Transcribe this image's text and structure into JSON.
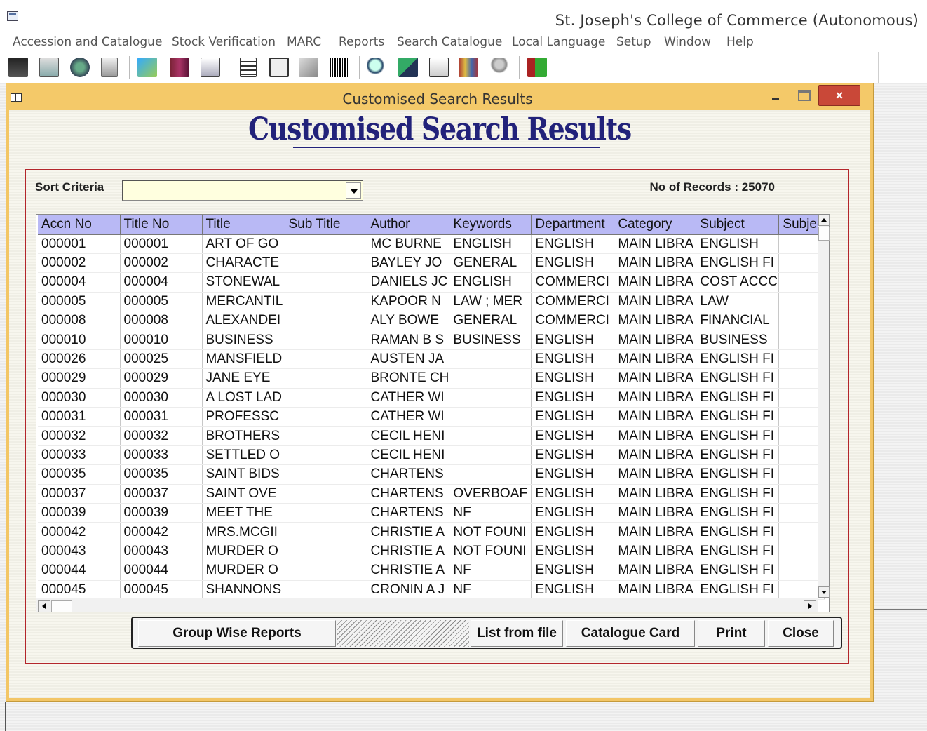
{
  "app": {
    "title": "St. Joseph's College of Commerce (Autonomous)",
    "menu": [
      "Accession and Catalogue",
      "Stock Verification",
      "MARC",
      "Reports",
      "Search Catalogue",
      "Local Language",
      "Setup",
      "Window",
      "Help"
    ]
  },
  "toolbar": {
    "icons": [
      "book-icon",
      "catalogue-icon",
      "globe-icon",
      "copy-icon",
      "stamp-icon",
      "books-icon",
      "mail-icon",
      "document-icon",
      "list-icon",
      "hand-icon",
      "barcode-icon",
      "search-icon",
      "find-book-icon",
      "edit-icon",
      "bookshelf-icon",
      "user-icon",
      "exit-icon"
    ]
  },
  "window": {
    "title": "Customised Search Results",
    "close_label": "×"
  },
  "page": {
    "heading": "Customised Search Results",
    "sort_label": "Sort Criteria",
    "sort_value": "",
    "records_label": "No of Records : 25070"
  },
  "grid": {
    "columns": [
      "Accn No",
      "Title No",
      "Title",
      "Sub Title",
      "Author",
      "Keywords",
      "Department",
      "Category",
      "Subject",
      "Subjec"
    ],
    "rows": [
      [
        "000001",
        "000001",
        "ART OF GO",
        "",
        "MC BURNE",
        "ENGLISH",
        "ENGLISH",
        "MAIN LIBRA",
        "ENGLISH",
        ""
      ],
      [
        "000002",
        "000002",
        "CHARACTE",
        "",
        "BAYLEY JO",
        "GENERAL",
        "ENGLISH",
        "MAIN LIBRA",
        "ENGLISH FI",
        ""
      ],
      [
        "000004",
        "000004",
        "STONEWAL",
        "",
        "DANIELS JC",
        "ENGLISH",
        "COMMERCI",
        "MAIN LIBRA",
        "COST ACCC",
        ""
      ],
      [
        "000005",
        "000005",
        "MERCANTIL",
        "",
        "KAPOOR N",
        "LAW ; MER",
        "COMMERCI",
        "MAIN LIBRA",
        "LAW",
        ""
      ],
      [
        "000008",
        "000008",
        "ALEXANDEI",
        "",
        "ALY BOWE",
        "GENERAL",
        "COMMERCI",
        "MAIN LIBRA",
        "FINANCIAL",
        ""
      ],
      [
        "000010",
        "000010",
        "BUSINESS",
        "",
        "RAMAN B S",
        "BUSINESS",
        "ENGLISH",
        "MAIN LIBRA",
        "BUSINESS",
        ""
      ],
      [
        "000026",
        "000025",
        "MANSFIELD",
        "",
        "AUSTEN JA",
        "",
        "ENGLISH",
        "MAIN LIBRA",
        "ENGLISH FI",
        ""
      ],
      [
        "000029",
        "000029",
        "JANE EYE",
        "",
        "BRONTE CH",
        "",
        "ENGLISH",
        "MAIN LIBRA",
        "ENGLISH FI",
        ""
      ],
      [
        "000030",
        "000030",
        "A LOST LAD",
        "",
        "CATHER WI",
        "",
        "ENGLISH",
        "MAIN LIBRA",
        "ENGLISH FI",
        ""
      ],
      [
        "000031",
        "000031",
        "PROFESSC",
        "",
        "CATHER WI",
        "",
        "ENGLISH",
        "MAIN LIBRA",
        "ENGLISH FI",
        ""
      ],
      [
        "000032",
        "000032",
        "BROTHERS",
        "",
        "CECIL HENI",
        "",
        "ENGLISH",
        "MAIN LIBRA",
        "ENGLISH FI",
        ""
      ],
      [
        "000033",
        "000033",
        "SETTLED O",
        "",
        "CECIL HENI",
        "",
        "ENGLISH",
        "MAIN LIBRA",
        "ENGLISH FI",
        ""
      ],
      [
        "000035",
        "000035",
        "SAINT BIDS",
        "",
        "CHARTENS",
        "",
        "ENGLISH",
        "MAIN LIBRA",
        "ENGLISH FI",
        ""
      ],
      [
        "000037",
        "000037",
        "SAINT OVE",
        "",
        "CHARTENS",
        "OVERBOAF",
        "ENGLISH",
        "MAIN LIBRA",
        "ENGLISH FI",
        ""
      ],
      [
        "000039",
        "000039",
        "MEET THE",
        "",
        "CHARTENS",
        "NF",
        "ENGLISH",
        "MAIN LIBRA",
        "ENGLISH FI",
        ""
      ],
      [
        "000042",
        "000042",
        "MRS.MCGII",
        "",
        "CHRISTIE A",
        "NOT FOUNI",
        "ENGLISH",
        "MAIN LIBRA",
        "ENGLISH FI",
        ""
      ],
      [
        "000043",
        "000043",
        "MURDER O",
        "",
        "CHRISTIE A",
        "NOT FOUNI",
        "ENGLISH",
        "MAIN LIBRA",
        "ENGLISH FI",
        ""
      ],
      [
        "000044",
        "000044",
        "MURDER O",
        "",
        "CHRISTIE A",
        "NF",
        "ENGLISH",
        "MAIN LIBRA",
        "ENGLISH FI",
        ""
      ],
      [
        "000045",
        "000045",
        "SHANNONS",
        "",
        "CRONIN A J",
        "NF",
        "ENGLISH",
        "MAIN LIBRA",
        "ENGLISH FI",
        ""
      ]
    ]
  },
  "buttons": {
    "group_wise": {
      "key": "G",
      "rest": "roup Wise Reports"
    },
    "list_from_file": {
      "key": "L",
      "rest": "ist from file"
    },
    "catalogue_card": {
      "pre": "C",
      "key": "a",
      "rest": "talogue Card"
    },
    "print": {
      "key": "P",
      "rest": "rint"
    },
    "close": {
      "key": "C",
      "rest": "lose"
    }
  },
  "colors": {
    "window_frame": "#f3c666",
    "heading": "#22227a",
    "grid_header": "#b9b9f5",
    "frame_border": "#b3262b",
    "close_button": "#c94838"
  }
}
